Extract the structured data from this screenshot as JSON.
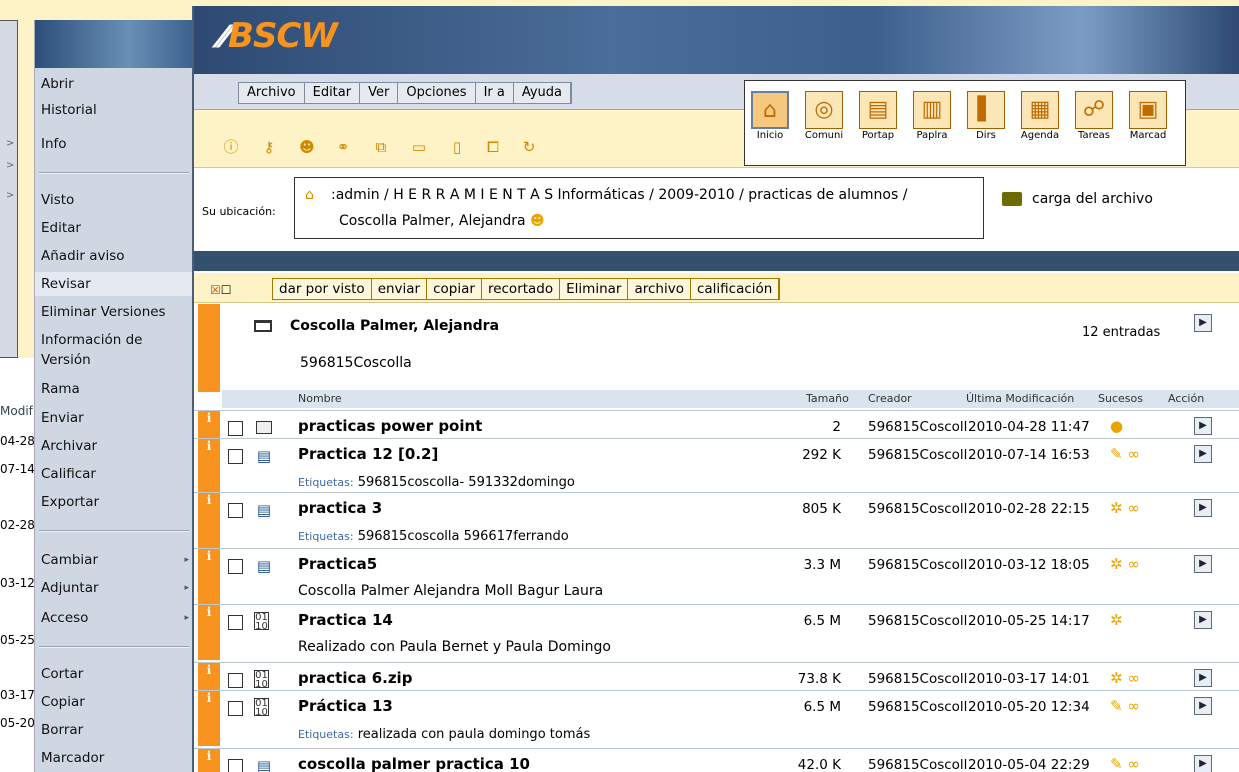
{
  "bg_window": {
    "col_header": "Modif",
    "dates": [
      "04-28",
      "07-14",
      "02-28",
      "03-12",
      "05-25",
      "03-17",
      "05-20"
    ]
  },
  "context_menu": {
    "items": [
      "Abrir",
      "Historial",
      "Info",
      "Visto",
      "Editar",
      "Añadir aviso",
      "Revisar",
      "Eliminar Versiones",
      "Información de Versión",
      "Rama",
      "Enviar",
      "Archivar",
      "Calificar",
      "Exportar",
      "Cambiar",
      "Adjuntar",
      "Acceso",
      "Cortar",
      "Copiar",
      "Borrar",
      "Marcador"
    ],
    "highlighted": "Revisar"
  },
  "app": {
    "logo": "BSCW",
    "menus": [
      "Archivo",
      "Editar",
      "Ver",
      "Opciones",
      "Ir a",
      "Ayuda"
    ],
    "nav_icons": [
      {
        "label": "Inicio",
        "icon": "home-icon"
      },
      {
        "label": "Comuni",
        "icon": "community-icon"
      },
      {
        "label": "Portap",
        "icon": "clipboard-icon"
      },
      {
        "label": "Paplra",
        "icon": "trash-icon"
      },
      {
        "label": "Dirs",
        "icon": "address-book-icon"
      },
      {
        "label": "Agenda",
        "icon": "calendar-icon"
      },
      {
        "label": "Tareas",
        "icon": "tasks-icon"
      },
      {
        "label": "Marcad",
        "icon": "bookmark-icon"
      }
    ]
  },
  "location": {
    "label": "Su ubicación:",
    "path_line1": ":admin / H E R R A M I E N T A S Informáticas / 2009-2010 / practicas de alumnos /",
    "path_line2": "Coscolla Palmer, Alejandra",
    "upload": "carga del archivo"
  },
  "actions": [
    "dar por visto",
    "enviar",
    "copiar",
    "recortado",
    "Eliminar",
    "archivo",
    "calificación"
  ],
  "folder": {
    "title": "Coscolla Palmer, Alejandra",
    "description": "596815Coscolla",
    "entries": "12 entradas"
  },
  "columns": {
    "name": "Nombre",
    "size": "Tamaño",
    "creator": "Creador",
    "modified": "Última Modificación",
    "events": "Sucesos",
    "action": "Acción"
  },
  "rows": [
    {
      "name": "practicas power point",
      "type": "folder",
      "size": "2",
      "creator": "596815Coscolla",
      "date": "2010-04-28 11:47",
      "events": "●",
      "tags_label": "",
      "tags": "",
      "desc": ""
    },
    {
      "name": "Practica 12 [0.2]",
      "type": "doc",
      "size": "292 K",
      "creator": "596815Coscolla",
      "date": "2010-07-14 16:53",
      "events": "✎ ∞",
      "tags_label": "Etiquetas:",
      "tags": "596815coscolla- 591332domingo",
      "desc": ""
    },
    {
      "name": "practica 3",
      "type": "doc",
      "size": "805 K",
      "creator": "596815Coscolla",
      "date": "2010-02-28 22:15",
      "events": "✲ ∞",
      "tags_label": "Etiquetas:",
      "tags": "596815coscolla 596617ferrando",
      "desc": ""
    },
    {
      "name": "Practica5",
      "type": "doc",
      "size": "3.3 M",
      "creator": "596815Coscolla",
      "date": "2010-03-12 18:05",
      "events": "✲ ∞",
      "tags_label": "",
      "tags": "",
      "desc": "Coscolla Palmer Alejandra Moll Bagur Laura"
    },
    {
      "name": "Practica 14",
      "type": "bin",
      "size": "6.5 M",
      "creator": "596815Coscolla",
      "date": "2010-05-25 14:17",
      "events": "✲",
      "tags_label": "",
      "tags": "",
      "desc": "Realizado con Paula Bernet y Paula Domingo"
    },
    {
      "name": "practica 6.zip",
      "type": "bin",
      "size": "73.8 K",
      "creator": "596815Coscolla",
      "date": "2010-03-17 14:01",
      "events": "✲ ∞",
      "tags_label": "",
      "tags": "",
      "desc": ""
    },
    {
      "name": "Práctica 13",
      "type": "bin",
      "size": "6.5 M",
      "creator": "596815Coscolla",
      "date": "2010-05-20 12:34",
      "events": "✎ ∞",
      "tags_label": "Etiquetas:",
      "tags": "realizada con paula domingo tomás",
      "desc": ""
    },
    {
      "name": "coscolla palmer practica 10",
      "type": "doc",
      "size": "42.0 K",
      "creator": "596815Coscolla",
      "date": "2010-05-04 22:29",
      "events": "✎ ∞",
      "tags_label": "",
      "tags": "",
      "desc": ""
    }
  ]
}
